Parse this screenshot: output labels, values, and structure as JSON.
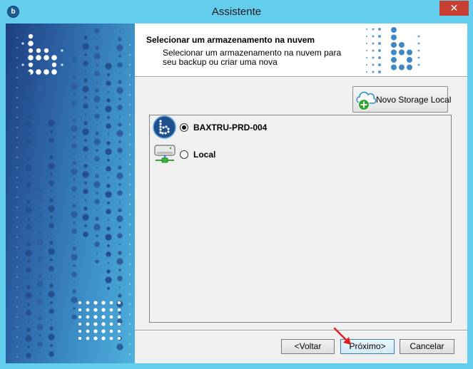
{
  "window": {
    "title": "Assistente",
    "app_icon_glyph": "b",
    "close_glyph": "✕",
    "frame_color": "#63cdee",
    "close_color": "#c84031"
  },
  "header": {
    "title": "Selecionar um armazenamento na nuvem",
    "subtitle": "Selecionar um armazenamento na nuvem para seu backup ou criar uma nova"
  },
  "toolbar": {
    "new_storage_label": "Novo Storage Local",
    "new_storage_icon": "cloud-add-icon"
  },
  "storages": [
    {
      "label": "BAXTRU-PRD-004",
      "icon": "baxtru-logo-icon",
      "selected": true
    },
    {
      "label": "Local",
      "icon": "local-drive-icon",
      "selected": false
    }
  ],
  "footer": {
    "back_label": "<Voltar",
    "next_label": "Próximo>",
    "cancel_label": "Cancelar"
  },
  "colors": {
    "banner_dark": "#1d3f80",
    "banner_light": "#4eb1dd",
    "logo_blue": "#3f88c5",
    "annotation_arrow": "#e01e1e"
  }
}
